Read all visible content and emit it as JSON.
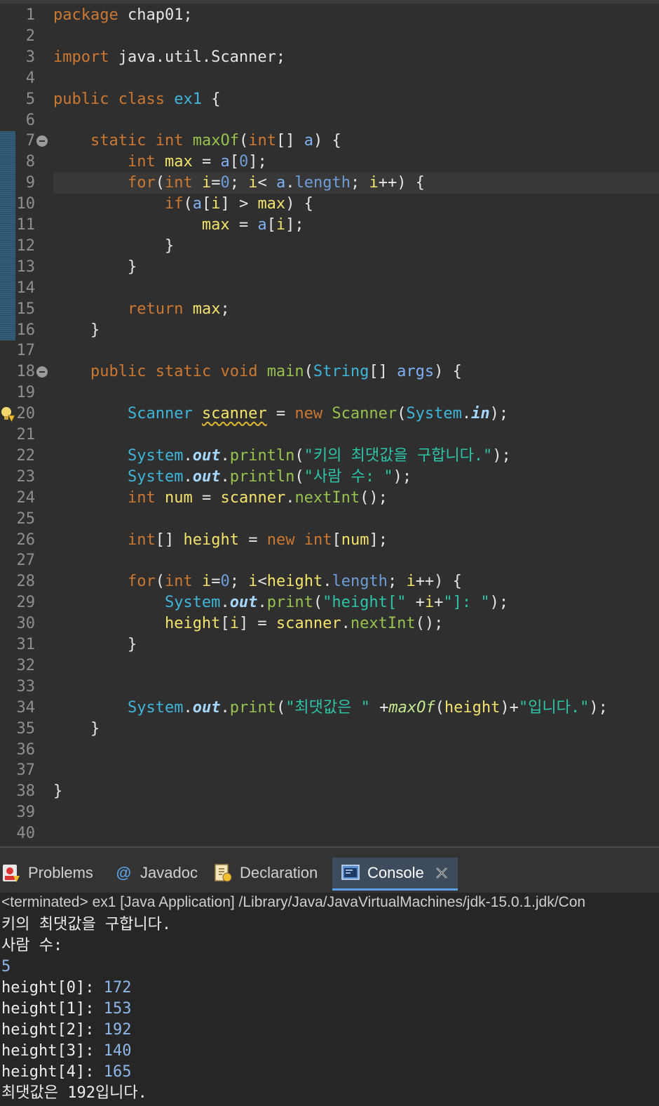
{
  "editor": {
    "lines": [
      {
        "n": "1",
        "segs": [
          [
            "kw",
            "package"
          ],
          [
            "pun",
            " chap01;"
          ]
        ]
      },
      {
        "n": "2",
        "segs": []
      },
      {
        "n": "3",
        "segs": [
          [
            "kw",
            "import"
          ],
          [
            "pun",
            " java.util.Scanner;"
          ]
        ]
      },
      {
        "n": "4",
        "segs": []
      },
      {
        "n": "5",
        "segs": [
          [
            "kw",
            "public"
          ],
          [
            "pun",
            " "
          ],
          [
            "kw",
            "class"
          ],
          [
            "pun",
            " "
          ],
          [
            "cls",
            "ex1"
          ],
          [
            "pun",
            " {"
          ]
        ]
      },
      {
        "n": "6",
        "segs": []
      },
      {
        "n": "7",
        "fold": true,
        "segs": [
          [
            "pun",
            "    "
          ],
          [
            "kw",
            "static"
          ],
          [
            "pun",
            " "
          ],
          [
            "ty",
            "int"
          ],
          [
            "pun",
            " "
          ],
          [
            "fn",
            "maxOf"
          ],
          [
            "pun",
            "("
          ],
          [
            "ty",
            "int"
          ],
          [
            "pun",
            "[] "
          ],
          [
            "par",
            "a"
          ],
          [
            "pun",
            ") {"
          ]
        ]
      },
      {
        "n": "8",
        "segs": [
          [
            "pun",
            "        "
          ],
          [
            "ty",
            "int"
          ],
          [
            "pun",
            " "
          ],
          [
            "var",
            "max"
          ],
          [
            "pun",
            " = "
          ],
          [
            "par",
            "a"
          ],
          [
            "pun",
            "["
          ],
          [
            "num",
            "0"
          ],
          [
            "pun",
            "];"
          ]
        ]
      },
      {
        "n": "9",
        "current": true,
        "segs": [
          [
            "pun",
            "        "
          ],
          [
            "kw",
            "for"
          ],
          [
            "pun",
            "("
          ],
          [
            "ty",
            "int"
          ],
          [
            "pun",
            " "
          ],
          [
            "var",
            "i"
          ],
          [
            "pun",
            "="
          ],
          [
            "num",
            "0"
          ],
          [
            "pun",
            "; "
          ],
          [
            "var",
            "i"
          ],
          [
            "pun",
            "< "
          ],
          [
            "par",
            "a"
          ],
          [
            "pun",
            "."
          ],
          [
            "fld",
            "length"
          ],
          [
            "pun",
            "; "
          ],
          [
            "var",
            "i"
          ],
          [
            "pun",
            "++) {"
          ]
        ]
      },
      {
        "n": "10",
        "segs": [
          [
            "pun",
            "            "
          ],
          [
            "kw",
            "if"
          ],
          [
            "pun",
            "("
          ],
          [
            "par",
            "a"
          ],
          [
            "pun",
            "["
          ],
          [
            "var",
            "i"
          ],
          [
            "pun",
            "] > "
          ],
          [
            "var",
            "max"
          ],
          [
            "pun",
            ") {"
          ]
        ]
      },
      {
        "n": "11",
        "segs": [
          [
            "pun",
            "                "
          ],
          [
            "var",
            "max"
          ],
          [
            "pun",
            " = "
          ],
          [
            "par",
            "a"
          ],
          [
            "pun",
            "["
          ],
          [
            "var",
            "i"
          ],
          [
            "pun",
            "];"
          ]
        ]
      },
      {
        "n": "12",
        "segs": [
          [
            "pun",
            "            }"
          ]
        ]
      },
      {
        "n": "13",
        "segs": [
          [
            "pun",
            "        }"
          ]
        ]
      },
      {
        "n": "14",
        "segs": []
      },
      {
        "n": "15",
        "segs": [
          [
            "pun",
            "        "
          ],
          [
            "kw",
            "return"
          ],
          [
            "pun",
            " "
          ],
          [
            "var",
            "max"
          ],
          [
            "pun",
            ";"
          ]
        ]
      },
      {
        "n": "16",
        "segs": [
          [
            "pun",
            "    }"
          ]
        ]
      },
      {
        "n": "17",
        "segs": []
      },
      {
        "n": "18",
        "fold": true,
        "segs": [
          [
            "pun",
            "    "
          ],
          [
            "kw",
            "public"
          ],
          [
            "pun",
            " "
          ],
          [
            "kw",
            "static"
          ],
          [
            "pun",
            " "
          ],
          [
            "ty",
            "void"
          ],
          [
            "pun",
            " "
          ],
          [
            "fn",
            "main"
          ],
          [
            "pun",
            "("
          ],
          [
            "cls",
            "String"
          ],
          [
            "pun",
            "[] "
          ],
          [
            "par",
            "args"
          ],
          [
            "pun",
            ") {"
          ]
        ]
      },
      {
        "n": "19",
        "segs": []
      },
      {
        "n": "20",
        "warn": true,
        "segs": [
          [
            "pun",
            "        "
          ],
          [
            "cls",
            "Scanner"
          ],
          [
            "pun",
            " "
          ],
          [
            "var squiggle",
            "scanner"
          ],
          [
            "pun",
            " = "
          ],
          [
            "kw",
            "new"
          ],
          [
            "pun",
            " "
          ],
          [
            "fn",
            "Scanner"
          ],
          [
            "pun",
            "("
          ],
          [
            "cls",
            "System"
          ],
          [
            "pun",
            "."
          ],
          [
            "stat",
            "in"
          ],
          [
            "pun",
            ");"
          ]
        ]
      },
      {
        "n": "21",
        "segs": []
      },
      {
        "n": "22",
        "segs": [
          [
            "pun",
            "        "
          ],
          [
            "cls",
            "System"
          ],
          [
            "pun",
            "."
          ],
          [
            "stat",
            "out"
          ],
          [
            "pun",
            "."
          ],
          [
            "fn",
            "println"
          ],
          [
            "pun",
            "("
          ],
          [
            "str",
            "\"키의 최댓값을 구합니다.\""
          ],
          [
            "pun",
            ");"
          ]
        ]
      },
      {
        "n": "23",
        "segs": [
          [
            "pun",
            "        "
          ],
          [
            "cls",
            "System"
          ],
          [
            "pun",
            "."
          ],
          [
            "stat",
            "out"
          ],
          [
            "pun",
            "."
          ],
          [
            "fn",
            "println"
          ],
          [
            "pun",
            "("
          ],
          [
            "str",
            "\"사람 수: \""
          ],
          [
            "pun",
            ");"
          ]
        ]
      },
      {
        "n": "24",
        "segs": [
          [
            "pun",
            "        "
          ],
          [
            "ty",
            "int"
          ],
          [
            "pun",
            " "
          ],
          [
            "var",
            "num"
          ],
          [
            "pun",
            " = "
          ],
          [
            "var",
            "scanner"
          ],
          [
            "pun",
            "."
          ],
          [
            "fn",
            "nextInt"
          ],
          [
            "pun",
            "();"
          ]
        ]
      },
      {
        "n": "25",
        "segs": []
      },
      {
        "n": "26",
        "segs": [
          [
            "pun",
            "        "
          ],
          [
            "ty",
            "int"
          ],
          [
            "pun",
            "[] "
          ],
          [
            "var",
            "height"
          ],
          [
            "pun",
            " = "
          ],
          [
            "kw",
            "new"
          ],
          [
            "pun",
            " "
          ],
          [
            "ty",
            "int"
          ],
          [
            "pun",
            "["
          ],
          [
            "var",
            "num"
          ],
          [
            "pun",
            "];"
          ]
        ]
      },
      {
        "n": "27",
        "segs": []
      },
      {
        "n": "28",
        "segs": [
          [
            "pun",
            "        "
          ],
          [
            "kw",
            "for"
          ],
          [
            "pun",
            "("
          ],
          [
            "ty",
            "int"
          ],
          [
            "pun",
            " "
          ],
          [
            "var",
            "i"
          ],
          [
            "pun",
            "="
          ],
          [
            "num",
            "0"
          ],
          [
            "pun",
            "; "
          ],
          [
            "var",
            "i"
          ],
          [
            "pun",
            "<"
          ],
          [
            "var",
            "height"
          ],
          [
            "pun",
            "."
          ],
          [
            "fld",
            "length"
          ],
          [
            "pun",
            "; "
          ],
          [
            "var",
            "i"
          ],
          [
            "pun",
            "++) {"
          ]
        ]
      },
      {
        "n": "29",
        "segs": [
          [
            "pun",
            "            "
          ],
          [
            "cls",
            "System"
          ],
          [
            "pun",
            "."
          ],
          [
            "stat",
            "out"
          ],
          [
            "pun",
            "."
          ],
          [
            "fn",
            "print"
          ],
          [
            "pun",
            "("
          ],
          [
            "str",
            "\"height[\""
          ],
          [
            "pun",
            " +"
          ],
          [
            "var",
            "i"
          ],
          [
            "pun",
            "+"
          ],
          [
            "str",
            "\"]: \""
          ],
          [
            "pun",
            ");"
          ]
        ]
      },
      {
        "n": "30",
        "segs": [
          [
            "pun",
            "            "
          ],
          [
            "var",
            "height"
          ],
          [
            "pun",
            "["
          ],
          [
            "var",
            "i"
          ],
          [
            "pun",
            "] = "
          ],
          [
            "var",
            "scanner"
          ],
          [
            "pun",
            "."
          ],
          [
            "fn",
            "nextInt"
          ],
          [
            "pun",
            "();"
          ]
        ]
      },
      {
        "n": "31",
        "segs": [
          [
            "pun",
            "        }"
          ]
        ]
      },
      {
        "n": "32",
        "segs": []
      },
      {
        "n": "33",
        "segs": []
      },
      {
        "n": "34",
        "segs": [
          [
            "pun",
            "        "
          ],
          [
            "cls",
            "System"
          ],
          [
            "pun",
            "."
          ],
          [
            "stat",
            "out"
          ],
          [
            "pun",
            "."
          ],
          [
            "fn",
            "print"
          ],
          [
            "pun",
            "("
          ],
          [
            "str",
            "\"최댓값은 \""
          ],
          [
            "pun",
            " +"
          ],
          [
            "smeth",
            "maxOf"
          ],
          [
            "pun",
            "("
          ],
          [
            "var",
            "height"
          ],
          [
            "pun",
            ")+"
          ],
          [
            "str",
            "\"입니다.\""
          ],
          [
            "pun",
            ");"
          ]
        ]
      },
      {
        "n": "35",
        "segs": [
          [
            "pun",
            "    }"
          ]
        ]
      },
      {
        "n": "36",
        "segs": []
      },
      {
        "n": "37",
        "segs": []
      },
      {
        "n": "38",
        "segs": [
          [
            "pun",
            "}"
          ]
        ]
      },
      {
        "n": "39",
        "segs": []
      },
      {
        "n": "40",
        "segs": []
      }
    ]
  },
  "panel": {
    "tabs": {
      "problems": "Problems",
      "javadoc": "Javadoc",
      "declaration": "Declaration",
      "console": "Console"
    },
    "status": "<terminated> ex1 [Java Application] /Library/Java/JavaVirtualMachines/jdk-15.0.1.jdk/Con",
    "output": [
      {
        "text": "키의 최댓값을 구합니다.",
        "input": ""
      },
      {
        "text": "사람 수: ",
        "input": ""
      },
      {
        "text": "",
        "input": "5"
      },
      {
        "text": "height[0]: ",
        "input": "172"
      },
      {
        "text": "height[1]: ",
        "input": "153"
      },
      {
        "text": "height[2]: ",
        "input": "192"
      },
      {
        "text": "height[3]: ",
        "input": "140"
      },
      {
        "text": "height[4]: ",
        "input": "165"
      },
      {
        "text": "최댓값은 192입니다.",
        "input": ""
      }
    ]
  },
  "colors": {
    "editor_bg": "#2f2f2f",
    "keyword": "#cc7832",
    "string": "#2ec4a7",
    "method": "#97c24f",
    "class": "#3fb6d9",
    "variable": "#f4e36b"
  }
}
